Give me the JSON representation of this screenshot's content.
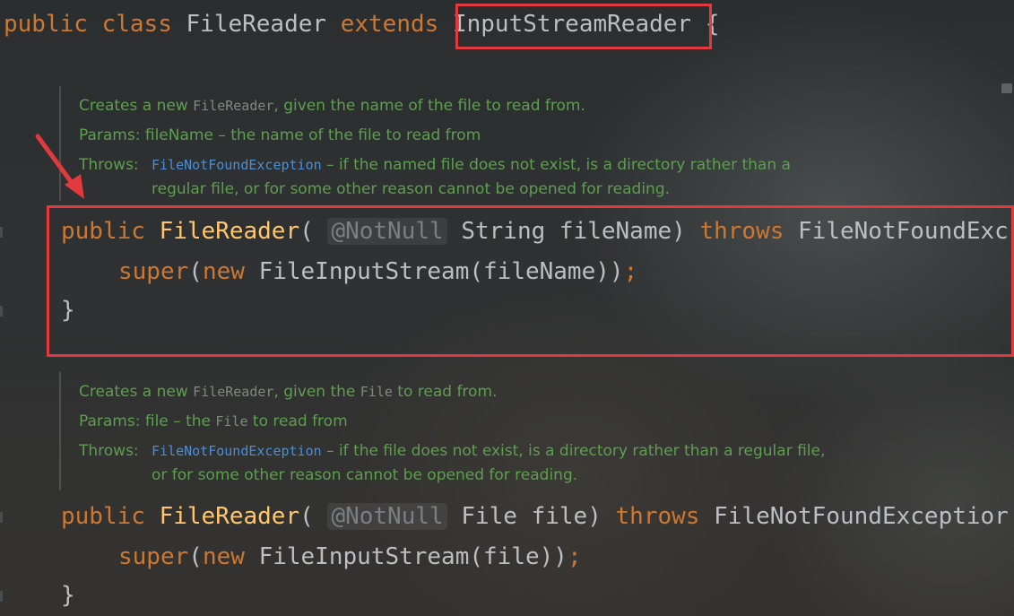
{
  "class_decl": {
    "public": "public",
    "class": "class",
    "name": "FileReader",
    "extends": "extends",
    "parent": "InputStreamReader",
    "brace": "{"
  },
  "doc1": {
    "intro_a": "Creates a new ",
    "intro_code": "FileReader",
    "intro_b": ", given the name of the file to read from.",
    "params_label": "Params:",
    "params_text": "fileName – the name of the file to read from",
    "throws_label": "Throws:",
    "throws_link": "FileNotFoundException",
    "throws_text_1": " – if the named file does not exist, is a directory rather than a",
    "throws_text_2": "regular file, or for some other reason cannot be opened for reading."
  },
  "ctor1": {
    "public": "public",
    "name": "FileReader",
    "open": "(",
    "annotation": "@NotNull",
    "param": "String fileName",
    "close": ")",
    "throws": "throws",
    "exception": "FileNotFoundExc",
    "super": "super",
    "body_open": "(",
    "new": "new",
    "body_rest": "FileInputStream(fileName))",
    "semicolon": ";",
    "end": "}"
  },
  "doc2": {
    "intro_a": "Creates a new ",
    "intro_code": "FileReader",
    "intro_b": ", given the ",
    "intro_code2": "File",
    "intro_c": " to read from.",
    "params_label": "Params:",
    "params_a": "file – the ",
    "params_code": "File",
    "params_b": " to read from",
    "throws_label": "Throws:",
    "throws_link": "FileNotFoundException",
    "throws_text_1": " – if the file does not exist, is a directory rather than a regular file,",
    "throws_text_2": "or for some other reason cannot be opened for reading."
  },
  "ctor2": {
    "public": "public",
    "name": "FileReader",
    "open": "(",
    "annotation": "@NotNull",
    "param": "File file",
    "close": ")",
    "throws": "throws",
    "exception": "FileNotFoundExceptior",
    "super": "super",
    "body_open": "(",
    "new": "new",
    "body_rest": "FileInputStream(file))",
    "semicolon": ";",
    "end": "}"
  },
  "colors": {
    "keyword": "#cc7832",
    "method": "#ffc66d",
    "plain": "#bcbec4",
    "doc_text": "#5e9e4f",
    "doc_link": "#4a8fd6",
    "highlight_border": "#e0393e"
  }
}
